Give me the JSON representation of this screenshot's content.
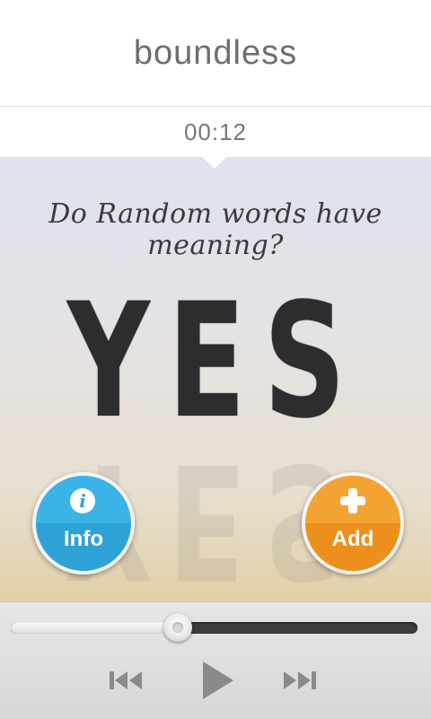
{
  "header": {
    "title": "boundless"
  },
  "player": {
    "elapsed_time": "00:12",
    "progress": 0.41
  },
  "artwork": {
    "question": "Do Random words have meaning?",
    "big_word": "YES"
  },
  "buttons": {
    "info": {
      "label": "Info",
      "icon": "info-icon",
      "color": "#2ea2d6"
    },
    "add": {
      "label": "Add",
      "icon": "plus-icon",
      "color": "#ec8f1c"
    }
  },
  "controls": {
    "previous_icon": "skip-previous-icon",
    "play_icon": "play-icon",
    "next_icon": "skip-next-icon"
  }
}
